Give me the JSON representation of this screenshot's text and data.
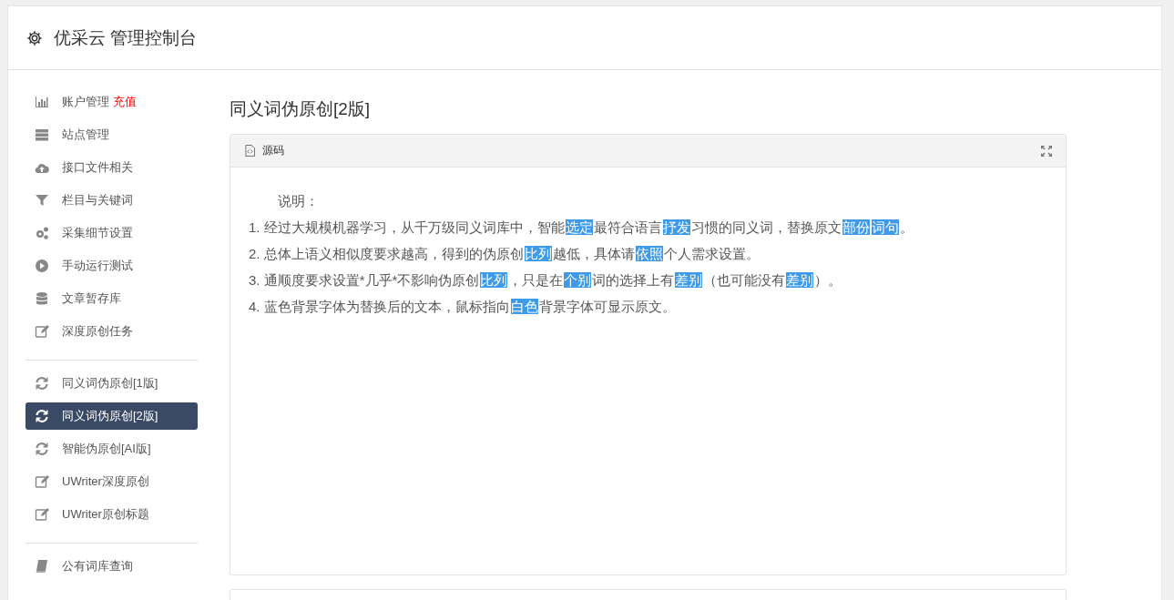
{
  "header": {
    "title": "优采云 管理控制台"
  },
  "sidebar": {
    "groups": [
      {
        "items": [
          {
            "label": "账户管理",
            "badge": "充值",
            "kind": "chart",
            "selected": false
          },
          {
            "label": "站点管理",
            "kind": "server",
            "selected": false
          },
          {
            "label": "接口文件相关",
            "kind": "cloud",
            "selected": false
          },
          {
            "label": "栏目与关键词",
            "kind": "filter",
            "selected": false
          },
          {
            "label": "采集细节设置",
            "kind": "gears",
            "selected": false
          },
          {
            "label": "手动运行测试",
            "kind": "play",
            "selected": false
          },
          {
            "label": "文章暂存库",
            "kind": "database",
            "selected": false
          },
          {
            "label": "深度原创任务",
            "kind": "edit",
            "selected": false
          }
        ]
      },
      {
        "items": [
          {
            "label": "同义词伪原创[1版]",
            "kind": "refresh",
            "selected": false
          },
          {
            "label": "同义词伪原创[2版]",
            "kind": "refresh",
            "selected": true
          },
          {
            "label": "智能伪原创[AI版]",
            "kind": "refresh",
            "selected": false
          },
          {
            "label": "UWriter深度原创",
            "kind": "edit",
            "selected": false
          },
          {
            "label": "UWriter原创标题",
            "kind": "edit",
            "selected": false
          }
        ]
      },
      {
        "items": [
          {
            "label": "公有词库查询",
            "kind": "book",
            "selected": false
          }
        ]
      }
    ]
  },
  "main": {
    "title": "同义词伪原创[2版]",
    "card": {
      "title": "源码",
      "heading": "说明：",
      "lines": [
        {
          "number": "1.",
          "parts": [
            {
              "text": "经过大规模机器学习，从千万级同义词库中，智能",
              "replaced": false
            },
            {
              "text": "选定",
              "replaced": true
            },
            {
              "text": "最符合语言",
              "replaced": false
            },
            {
              "text": "抒发",
              "replaced": true
            },
            {
              "text": "习惯的同义词，替换原文",
              "replaced": false
            },
            {
              "text": "部份",
              "replaced": true
            },
            {
              "text": "词句",
              "replaced": true
            },
            {
              "text": "。",
              "replaced": false
            }
          ]
        },
        {
          "number": "2.",
          "parts": [
            {
              "text": "总体上语义相似度要求越高，得到的伪原创",
              "replaced": false
            },
            {
              "text": "比列",
              "replaced": true
            },
            {
              "text": "越低，具体请",
              "replaced": false
            },
            {
              "text": "依照",
              "replaced": true
            },
            {
              "text": "个人需求设置。",
              "replaced": false
            }
          ]
        },
        {
          "number": "3.",
          "parts": [
            {
              "text": "通顺度要求设置*几乎*不影响伪原创",
              "replaced": false
            },
            {
              "text": "比列",
              "replaced": true
            },
            {
              "text": "，只是在",
              "replaced": false
            },
            {
              "text": "个别",
              "replaced": true
            },
            {
              "text": "词的选择上有",
              "replaced": false
            },
            {
              "text": "差别",
              "replaced": true
            },
            {
              "text": "（也可能没有",
              "replaced": false
            },
            {
              "text": "差别",
              "replaced": true
            },
            {
              "text": "）。",
              "replaced": false
            }
          ]
        },
        {
          "number": "4.",
          "parts": [
            {
              "text": "蓝色背景字体为替换后的文本，鼠标指向",
              "replaced": false
            },
            {
              "text": "白色",
              "replaced": true
            },
            {
              "text": "背景字体可显示原文。",
              "replaced": false
            }
          ]
        }
      ]
    }
  }
}
